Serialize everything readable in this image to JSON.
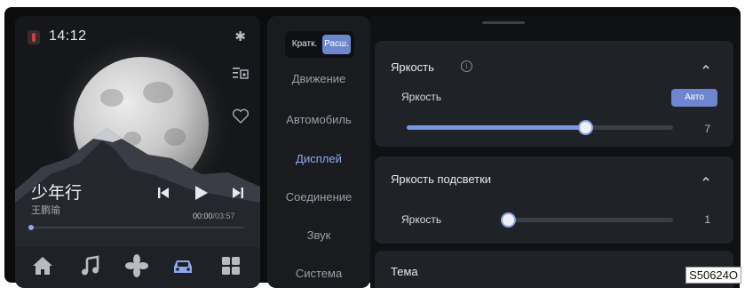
{
  "media": {
    "clock": "14:12",
    "song_title": "少年行",
    "artist": "王鹏瑜",
    "time_current": "00:00",
    "time_total": "/03:57",
    "progress": 0.0,
    "icons": [
      "car-brand-icon",
      "bluetooth-icon",
      "playlist-icon",
      "heart-icon",
      "previous-icon",
      "play-icon",
      "next-icon"
    ],
    "dock": [
      "home-icon",
      "music-icon",
      "fan-icon",
      "car-icon",
      "apps-icon"
    ]
  },
  "nav": {
    "segments": [
      "Кратк.",
      "Расш."
    ],
    "active_segment": "Расш.",
    "items": [
      "Движение",
      "Автомобиль",
      "Дисплей",
      "Соединение",
      "Звук",
      "Система"
    ],
    "active_item": "Дисплей"
  },
  "settings": {
    "brightness": {
      "title": "Яркость",
      "row_label": "Яркость",
      "auto_label": "Авто",
      "value": "7",
      "level": 0.67
    },
    "backlight": {
      "title": "Яркость подсветки",
      "row_label": "Яркость",
      "value": "1",
      "level": 0.0
    },
    "theme": {
      "title": "Тема"
    }
  },
  "code": "S50624O",
  "colors": {
    "accent": "#6d86cf",
    "background": "#0b0c0e"
  }
}
